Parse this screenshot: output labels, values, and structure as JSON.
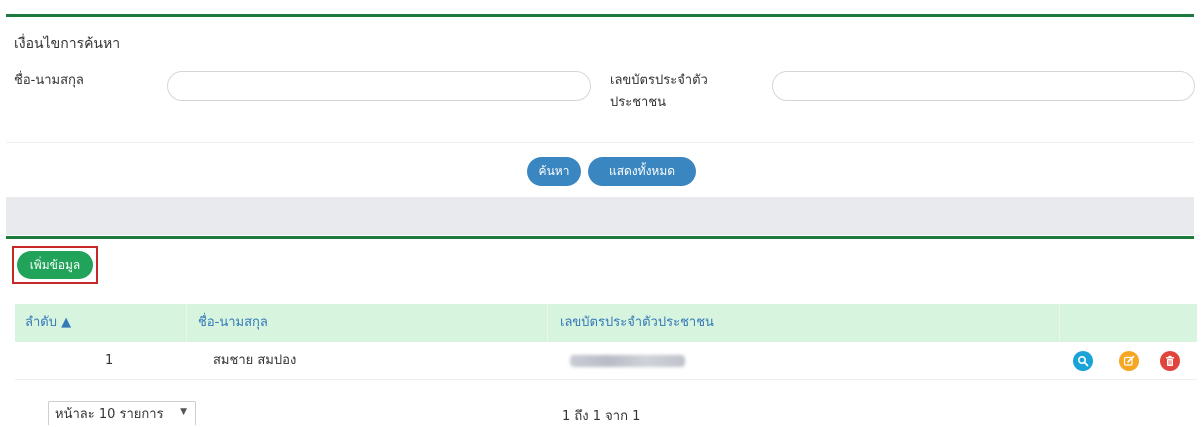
{
  "search": {
    "title": "เงื่อนไขการค้นหา",
    "name_label": "ชื่อ-นามสกุล",
    "id_label_line1": "เลขบัตรประจำตัว",
    "id_label_line2": "ประชาชน",
    "name_value": "",
    "id_value": "",
    "search_button": "ค้นหา",
    "show_all_button": "แสดงทั้งหมด"
  },
  "toolbar": {
    "add_button": "เพิ่มข้อมูล"
  },
  "table": {
    "columns": [
      "ลำดับ ▲",
      "ชื่อ-นามสกุล",
      "เลขบัตรประจำตัวประชาชน",
      ""
    ],
    "rows": [
      {
        "index": "1",
        "name": "สมชาย สมปอง"
      }
    ]
  },
  "pagination": {
    "per_page": "หน้าละ 10 รายการ",
    "info": "1 ถึง 1 จาก 1"
  },
  "icons": {
    "view": "search-icon",
    "edit": "edit-icon",
    "delete": "trash-icon"
  },
  "colors": {
    "accent_green": "#1e7a3c",
    "add_button": "#21a35a",
    "primary_blue": "#3a86c0",
    "header_bg": "#d7f4df",
    "view_icon": "#1aa3d9",
    "edit_icon": "#f5a623",
    "delete_icon": "#e0443a"
  }
}
